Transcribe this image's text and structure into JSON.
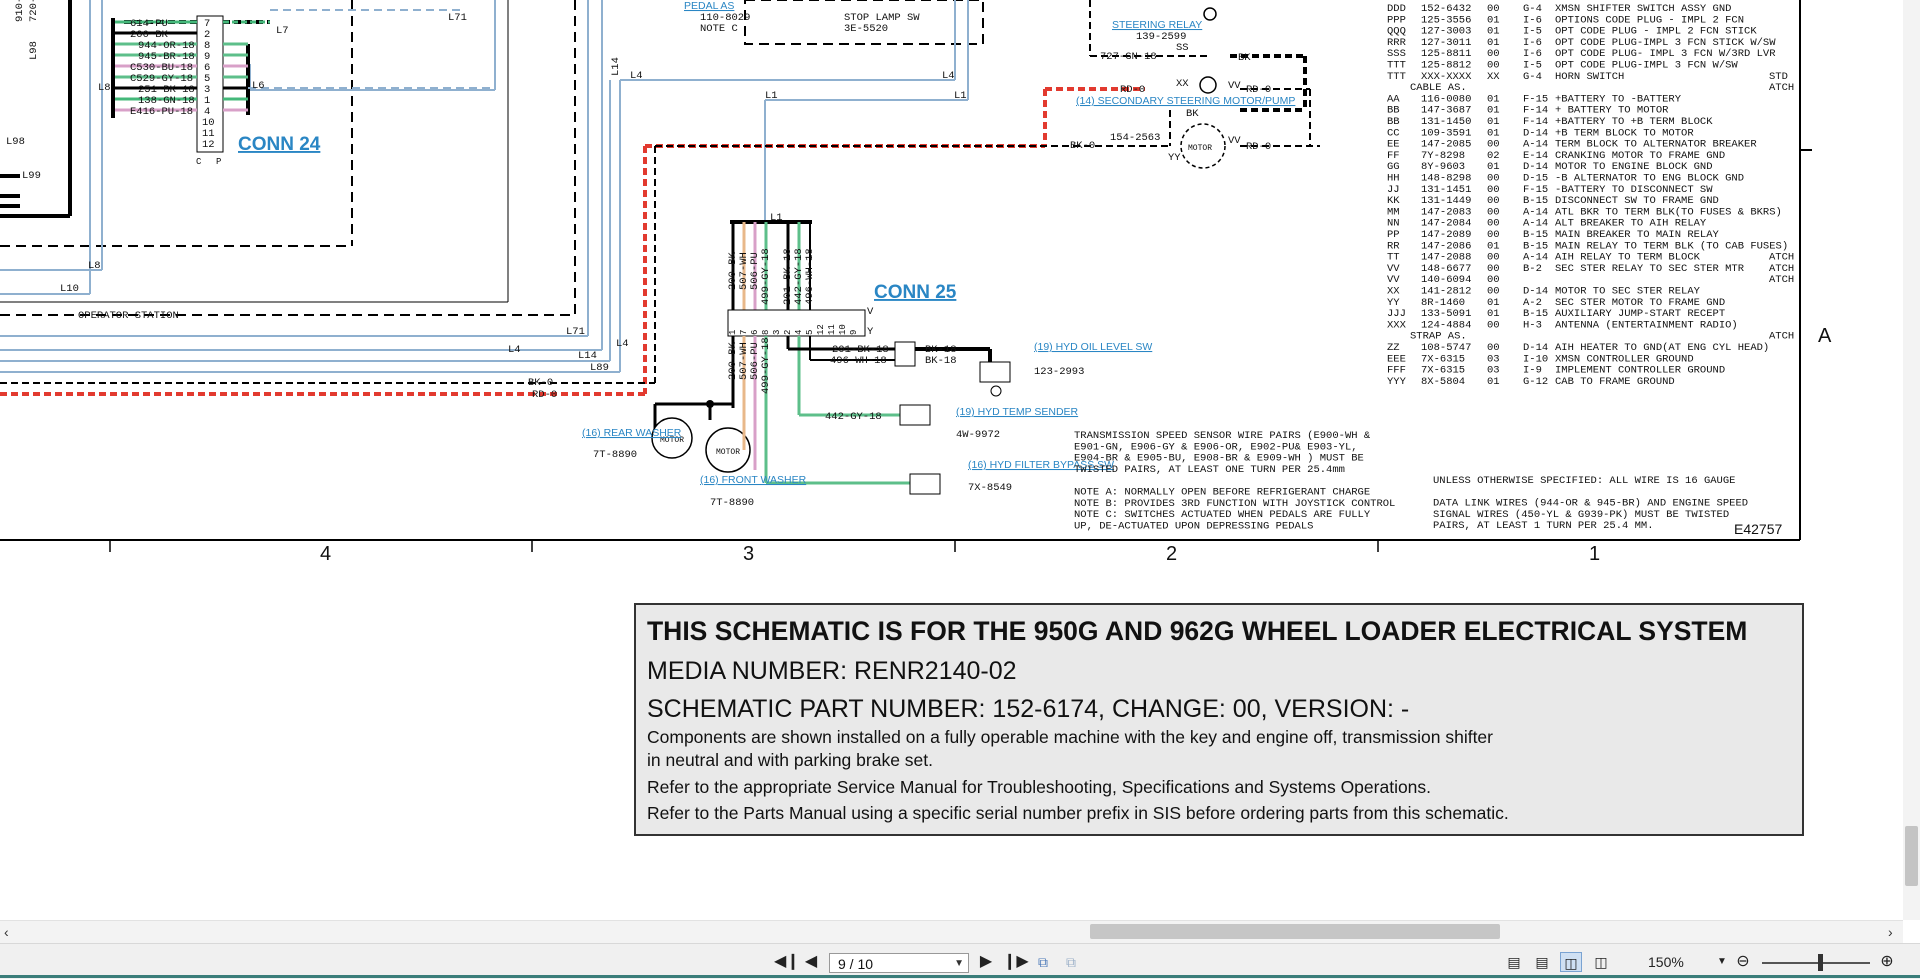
{
  "conn24": {
    "title": "CONN 24",
    "wires": [
      "614-PU",
      "200-BK",
      "944-OR-18",
      "945-BR-18",
      "C530-BU-18",
      "C529-GY-18",
      "251-BK-18",
      "138-GN-18",
      "E416-PU-18"
    ],
    "pins": [
      "7",
      "2",
      "8",
      "9",
      "6",
      "5",
      "3",
      "1",
      "4",
      "10",
      "11",
      "12"
    ],
    "side_labels": [
      "L7",
      "L6"
    ],
    "bottom_labels": [
      "C",
      "P"
    ]
  },
  "conn25": {
    "title": "CONN 25",
    "wires": [
      "200-BK",
      "507-WH",
      "506-PU",
      "499-GY-18",
      "201-BK-18",
      "442-GY-18",
      "496-WH-18"
    ],
    "pins": [
      "1",
      "7",
      "6",
      "8",
      "3",
      "2",
      "4",
      "5",
      "12",
      "11",
      "10",
      "9"
    ],
    "side_labels": [
      "V",
      "Y"
    ],
    "lower_wires": [
      "200-BK",
      "507-WH",
      "506-PU",
      "499-GY-18"
    ],
    "out_wires": [
      "201-BK-18",
      "496-WH-18",
      "442-GY-18"
    ]
  },
  "line_labels": [
    "L71",
    "L98",
    "L99",
    "L8",
    "L10",
    "L14",
    "L4",
    "L1",
    "L89",
    "L71",
    "L14",
    "L4"
  ],
  "top_labels": [
    "910-",
    "720-",
    "L98"
  ],
  "operator_station": "OPERATOR STATION",
  "wire_labels": {
    "bk0": "BK-0",
    "rd0": "RD-0",
    "gn18": "727-GN-18",
    "bk": "BK",
    "vv": "VV",
    "xx": "XX",
    "yy": "YY",
    "ss": "SS",
    "bk18": "BK-18"
  },
  "components": [
    {
      "name": "(16) REAR WASHER",
      "part": "7T-8890",
      "label": "MOTOR"
    },
    {
      "name": "(16) FRONT WASHER",
      "part": "7T-8890",
      "label": "MOTOR"
    },
    {
      "name": "(19) HYD OIL LEVEL SW",
      "part": "123-2993"
    },
    {
      "name": "(19) HYD TEMP SENDER",
      "part": "4W-9972"
    },
    {
      "name": "(16) HYD FILTER BYPASS SW",
      "part": "7X-8549"
    },
    {
      "name": "(14) SECONDARY STEERING MOTOR/PUMP",
      "part": "154-2563",
      "label": "MOTOR"
    },
    {
      "name": "STEERING RELAY",
      "part": "139-2599"
    },
    {
      "name": "PEDAL AS",
      "part": "110-8029",
      "note": "NOTE C"
    },
    {
      "name": "STOP LAMP SW",
      "part": "3E-5520"
    }
  ],
  "parts_table": [
    [
      "DDD",
      "152-6432",
      "00",
      "G-4",
      "XMSN SHIFTER SWITCH ASSY GND",
      ""
    ],
    [
      "PPP",
      "125-3556",
      "01",
      "I-6",
      "OPTIONS CODE PLUG - IMPL 2 FCN",
      ""
    ],
    [
      "QQQ",
      "127-3003",
      "01",
      "I-5",
      "OPT CODE PLUG - IMPL 2 FCN STICK",
      ""
    ],
    [
      "RRR",
      "127-3011",
      "01",
      "I-6",
      "OPT CODE PLUG-IMPL 3 FCN STICK W/SW",
      ""
    ],
    [
      "SSS",
      "125-8811",
      "00",
      "I-6",
      "OPT CODE PLUG- IMPL 3 FCN W/3RD LVR",
      ""
    ],
    [
      "TTT",
      "125-8812",
      "00",
      "I-5",
      "OPT CODE PLUG-IMPL 3 FCN W/SW",
      ""
    ],
    [
      "TTT",
      "XXX-XXXX",
      "XX",
      "G-4",
      "HORN SWITCH",
      "STD"
    ],
    [
      "CABLE AS.",
      "",
      "",
      "",
      "",
      "ATCH"
    ],
    [
      "AA",
      "116-0080",
      "01",
      "F-15",
      "+BATTERY TO -BATTERY",
      ""
    ],
    [
      "BB",
      "147-3687",
      "01",
      "F-14",
      "+ BATTERY TO MOTOR",
      ""
    ],
    [
      "BB",
      "131-1450",
      "01",
      "F-14",
      "+BATTERY TO +B TERM BLOCK",
      ""
    ],
    [
      "CC",
      "109-3591",
      "01",
      "D-14",
      "+B TERM BLOCK TO MOTOR",
      ""
    ],
    [
      "EE",
      "147-2085",
      "00",
      "A-14",
      "TERM BLOCK TO ALTERNATOR BREAKER",
      ""
    ],
    [
      "FF",
      "7Y-8298",
      "02",
      "E-14",
      "CRANKING MOTOR TO FRAME GND",
      ""
    ],
    [
      "GG",
      "8Y-9603",
      "01",
      "D-14",
      "MOTOR TO ENGINE BLOCK GND",
      ""
    ],
    [
      "HH",
      "148-8298",
      "00",
      "D-15",
      "-B ALTERNATOR TO ENG BLOCK GND",
      ""
    ],
    [
      "JJ",
      "131-1451",
      "00",
      "F-15",
      "-BATTERY TO DISCONNECT SW",
      ""
    ],
    [
      "KK",
      "131-1449",
      "00",
      "B-15",
      "DISCONNECT SW TO FRAME GND",
      ""
    ],
    [
      "MM",
      "147-2083",
      "00",
      "A-14",
      "ATL BKR TO TERM BLK(TO FUSES & BKRS)",
      ""
    ],
    [
      "NN",
      "147-2084",
      "00",
      "A-14",
      "ALT BREAKER TO AIH RELAY",
      ""
    ],
    [
      "PP",
      "147-2089",
      "00",
      "B-15",
      "MAIN BREAKER TO MAIN RELAY",
      ""
    ],
    [
      "RR",
      "147-2086",
      "01",
      "B-15",
      "MAIN RELAY TO TERM BLK (TO CAB FUSES)",
      ""
    ],
    [
      "TT",
      "147-2088",
      "00",
      "A-14",
      "AIH RELAY TO TERM BLOCK",
      "ATCH"
    ],
    [
      "VV",
      "148-6677",
      "00",
      "B-2",
      "SEC STER RELAY TO SEC STER MTR",
      "ATCH"
    ],
    [
      "VV",
      "140-6094",
      "00",
      "",
      "",
      "ATCH"
    ],
    [
      "XX",
      "141-2812",
      "00",
      "D-14",
      "MOTOR TO SEC STER RELAY",
      ""
    ],
    [
      "YY",
      "8R-1460",
      "01",
      "A-2",
      "SEC STER MOTOR TO FRAME GND",
      ""
    ],
    [
      "JJJ",
      "133-5091",
      "01",
      "B-15",
      "AUXILIARY JUMP-START RECEPT",
      ""
    ],
    [
      "XXX",
      "124-4884",
      "00",
      "H-3",
      "ANTENNA (ENTERTAINMENT RADIO)",
      ""
    ],
    [
      "STRAP AS.",
      "",
      "",
      "",
      "",
      "ATCH"
    ],
    [
      "ZZ",
      "108-5747",
      "00",
      "D-14",
      "AIH HEATER TO GND(AT ENG CYL HEAD)",
      ""
    ],
    [
      "EEE",
      "7X-6315",
      "03",
      "I-10",
      "XMSN CONTROLLER GROUND",
      ""
    ],
    [
      "FFF",
      "7X-6315",
      "03",
      "I-9",
      "IMPLEMENT CONTROLLER GROUND",
      ""
    ],
    [
      "YYY",
      "8X-5804",
      "01",
      "G-12",
      "CAB TO FRAME GROUND",
      ""
    ]
  ],
  "notes": [
    "TRANSMISSION SPEED SENSOR WIRE PAIRS      (E900-WH &",
    "E901-GN, E906-GY & E906-OR, E902-PU& E903-YL,",
    "E904-BR & E905-BU, E908-BR & E909-WH ) MUST BE",
    "TWISTED PAIRS, AT LEAST ONE TURN PER    25.4mm",
    "",
    "NOTE A: NORMALLY OPEN BEFORE REFRIGERANT CHARGE",
    "NOTE B: PROVIDES 3RD FUNCTION WITH JOYSTICK CONTROL",
    "NOTE C: SWITCHES ACTUATED WHEN PEDALS ARE FULLY",
    "        UP, DE-ACTUATED UPON DEPRESSING PEDALS"
  ],
  "notes_right": [
    "UNLESS OTHERWISE SPECIFIED: ALL WIRE IS 16 GAUGE",
    "",
    "DATA LINK WIRES (944-OR & 945-BR) AND ENGINE SPEED",
    "SIGNAL WIRES (450-YL & G939-PK) MUST BE TWISTED",
    "PAIRS, AT LEAST 1 TURN PER 25.4 MM."
  ],
  "drawing_id": "E42757",
  "zone_numbers": [
    "4",
    "3",
    "2",
    "1"
  ],
  "zone_letter": "A",
  "info": {
    "title": "THIS SCHEMATIC IS FOR THE 950G AND 962G WHEEL LOADER ELECTRICAL SYSTEM",
    "media": "MEDIA NUMBER: RENR2140-02",
    "part": "SCHEMATIC PART NUMBER: 152-6174, CHANGE: 00, VERSION: -",
    "line1": "Components are shown installed on a fully operable machine with the key and engine off, transmission shifter",
    "line2": "in neutral and with parking brake set.",
    "line3": "Refer to the appropriate Service Manual for Troubleshooting, Specifications and Systems Operations.",
    "line4": "Refer to the Parts Manual using a specific serial number prefix in SIS before ordering parts from this schematic."
  },
  "toolbar": {
    "page_value": "9 / 10",
    "zoom": "150%",
    "first_icon": "first-page-icon",
    "prev_icon": "prev-page-icon",
    "next_icon": "next-page-icon",
    "last_icon": "last-page-icon",
    "colors": {
      "bar": "#f0f0f0",
      "accent": "#3a7d7a"
    }
  },
  "colors": {
    "red": "#e23a2f",
    "blue": "#8fb0cf",
    "green": "#5dbf8a",
    "tan": "#e8b88a",
    "pink": "#d8a0c8",
    "link": "#2a86c4"
  }
}
